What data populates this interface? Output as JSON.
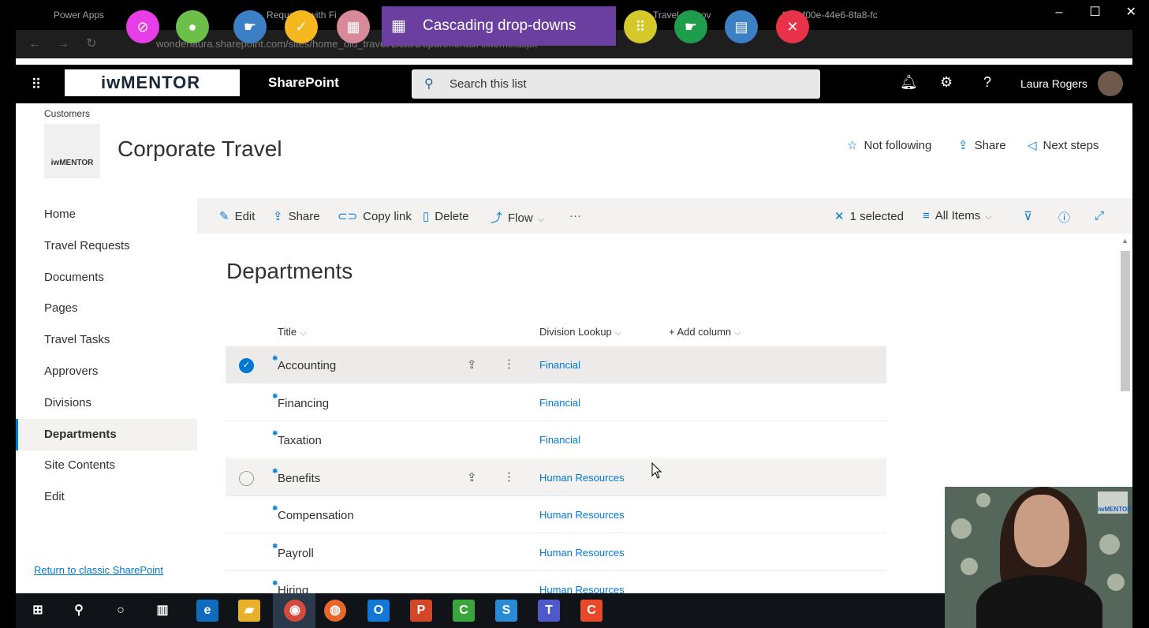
{
  "browser": {
    "tabs": [
      "Power Apps",
      "Requests with Fi",
      "Travel Approv",
      "fcc8-f00e-44e6-8fa8-fc"
    ],
    "address": "wonderlaura.sharepoint.com/sites/home_old_travel/Lists/Departments/AllItems.aspx",
    "window_controls": [
      "–",
      "☐",
      "✕"
    ]
  },
  "recorder": {
    "title": "Cascading drop-downs",
    "title_icon": "building-icon",
    "circles": [
      {
        "name": "compass-icon",
        "glyph": "⊘",
        "color": "#e83ee8"
      },
      {
        "name": "person-icon",
        "glyph": "●",
        "color": "#6cc04a"
      },
      {
        "name": "hand-icon",
        "glyph": "☛",
        "color": "#3b7fc4"
      },
      {
        "name": "check-icon",
        "glyph": "✓",
        "color": "#f5b91f"
      },
      {
        "name": "building-icon",
        "glyph": "▦",
        "color": "#d88a9a"
      },
      {
        "name": "braille-icon",
        "glyph": "⠿",
        "color": "#d4c82a"
      },
      {
        "name": "hand-icon-2",
        "glyph": "☛",
        "color": "#1e9e4c"
      },
      {
        "name": "document-icon",
        "glyph": "▤",
        "color": "#3b7fc4"
      },
      {
        "name": "tools-icon",
        "glyph": "✕",
        "color": "#e8324a"
      }
    ]
  },
  "suitebar": {
    "logo": "iwMENTOR",
    "app": "SharePoint",
    "search_placeholder": "Search this list",
    "user": "Laura Rogers"
  },
  "site": {
    "breadcrumb": "Customers",
    "title": "Corporate Travel",
    "logo_text": "iwMENTOR",
    "actions": {
      "follow": "Not following",
      "share": "Share",
      "next": "Next steps"
    }
  },
  "nav": {
    "items": [
      "Home",
      "Travel Requests",
      "Documents",
      "Pages",
      "Travel Tasks",
      "Approvers",
      "Divisions",
      "Departments",
      "Site Contents",
      "Edit"
    ],
    "active": "Departments",
    "return": "Return to classic SharePoint"
  },
  "commands": {
    "edit": "Edit",
    "share": "Share",
    "copy": "Copy link",
    "delete": "Delete",
    "flow": "Flow",
    "more": "···",
    "selected": "1 selected",
    "view": "All Items"
  },
  "list": {
    "title": "Departments",
    "columns": {
      "title": "Title",
      "lookup": "Division Lookup",
      "add": "+ Add column"
    },
    "rows": [
      {
        "title": "Accounting",
        "division": "Financial",
        "state": "selected"
      },
      {
        "title": "Financing",
        "division": "Financial",
        "state": "normal"
      },
      {
        "title": "Taxation",
        "division": "Financial",
        "state": "normal"
      },
      {
        "title": "Benefits",
        "division": "Human Resources",
        "state": "hover"
      },
      {
        "title": "Compensation",
        "division": "Human Resources",
        "state": "normal"
      },
      {
        "title": "Payroll",
        "division": "Human Resources",
        "state": "normal"
      },
      {
        "title": "Hiring",
        "division": "Human Resources",
        "state": "normal"
      }
    ]
  },
  "webcam": {
    "logo": "iwMENTOR"
  },
  "taskbar": {
    "icons": [
      {
        "name": "windows-start-icon",
        "glyph": "⊞",
        "color": "#101418"
      },
      {
        "name": "search-icon",
        "glyph": "⚲",
        "color": "#101418"
      },
      {
        "name": "cortana-icon",
        "glyph": "○",
        "color": "#101418"
      },
      {
        "name": "task-view-icon",
        "glyph": "▥",
        "color": "#101418"
      },
      {
        "name": "edge-icon",
        "glyph": "e",
        "color": "#0f6cbd"
      },
      {
        "name": "file-explorer-icon",
        "glyph": "▰",
        "color": "#e8b12b"
      },
      {
        "name": "chrome-icon",
        "glyph": "◉",
        "color": "#d54a3a"
      },
      {
        "name": "firefox-icon",
        "glyph": "◍",
        "color": "#e8662a"
      },
      {
        "name": "outlook-icon",
        "glyph": "O",
        "color": "#1477d4"
      },
      {
        "name": "powerpoint-icon",
        "glyph": "P",
        "color": "#d24726"
      },
      {
        "name": "camtasia-icon",
        "glyph": "C",
        "color": "#3aa53a"
      },
      {
        "name": "sway-icon",
        "glyph": "S",
        "color": "#2a8ad4"
      },
      {
        "name": "teams-icon",
        "glyph": "T",
        "color": "#5059c9"
      },
      {
        "name": "camtasia-recorder-icon",
        "glyph": "C",
        "color": "#e8492b"
      }
    ]
  }
}
